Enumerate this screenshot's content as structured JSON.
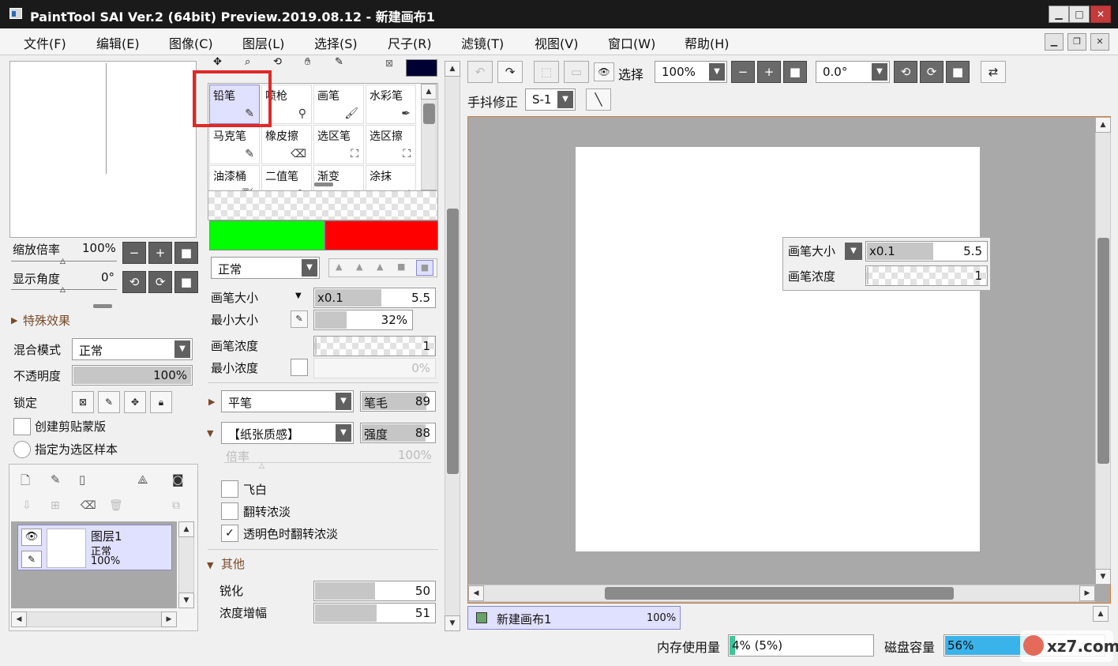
{
  "window": {
    "title": "PaintTool SAI Ver.2 (64bit) Preview.2019.08.12 - 新建画布1",
    "icon": "app-icon",
    "min": "▁",
    "max": "□",
    "close": "✕"
  },
  "menu": [
    "文件(F)",
    "编辑(E)",
    "图像(C)",
    "图层(L)",
    "选择(S)",
    "尺子(R)",
    "滤镜(T)",
    "视图(V)",
    "窗口(W)",
    "帮助(H)"
  ],
  "navigator": {
    "zoom_label": "缩放倍率",
    "zoom_value": "100%",
    "angle_label": "显示角度",
    "angle_value": "0°"
  },
  "effects": {
    "section": "特殊效果",
    "blend_label": "混合模式",
    "blend_value": "正常",
    "opacity_label": "不透明度",
    "opacity_value": "100%",
    "opacity_fraction": 1.0,
    "lock_label": "锁定",
    "clip_label": "创建剪贴蒙版",
    "sample_label": "指定为选区样本"
  },
  "layers": [
    {
      "name": "图层1",
      "mode": "正常",
      "opacity": "100%"
    }
  ],
  "tools": [
    {
      "name": "铅笔",
      "icon": "pencil-icon",
      "selected": true
    },
    {
      "name": "喷枪",
      "icon": "airbrush-icon"
    },
    {
      "name": "画笔",
      "icon": "brush-icon"
    },
    {
      "name": "水彩笔",
      "icon": "watercolor-icon"
    },
    {
      "name": "马克笔",
      "icon": "marker-icon"
    },
    {
      "name": "橡皮擦",
      "icon": "eraser-icon"
    },
    {
      "name": "选区笔",
      "icon": "selpen-icon"
    },
    {
      "name": "选区擦",
      "icon": "selerase-icon"
    },
    {
      "name": "油漆桶",
      "icon": "bucket-icon"
    },
    {
      "name": "二值笔",
      "icon": "binary-icon"
    },
    {
      "name": "渐变",
      "icon": "gradient-icon"
    },
    {
      "name": "涂抹",
      "icon": "smudge-icon"
    }
  ],
  "colors": {
    "primary": "#00ff00",
    "secondary": "#ff0000",
    "swatch": "#000033"
  },
  "brush": {
    "mode": "正常",
    "size_label": "画笔大小",
    "size_mult": "x0.1",
    "size_value": "5.5",
    "size_fraction": 0.6,
    "min_size_label": "最小大小",
    "min_size_value": "32%",
    "min_size_fraction": 0.32,
    "density_label": "画笔浓度",
    "density_value": "1",
    "density_fraction": 0.01,
    "min_density_label": "最小浓度",
    "min_density_value": "0%",
    "shape": "平笔",
    "bristle_label": "笔毛",
    "bristle_value": "89",
    "bristle_fraction": 0.89,
    "texture": "【纸张质感】",
    "strength_label": "强度",
    "strength_value": "88",
    "strength_fraction": 0.88,
    "scale_label": "倍率",
    "scale_value": "100%",
    "fly_white": "飞白",
    "invert_density": "翻转浓淡",
    "invert_transparent": "透明色时翻转浓淡",
    "other_section": "其他",
    "sharpen_label": "锐化",
    "sharpen_value": "50",
    "sharpen_fraction": 0.5,
    "density_boost_label": "浓度增幅",
    "density_boost_value": "51",
    "density_boost_fraction": 0.51
  },
  "toolbar": {
    "select_label": "选择",
    "zoom": "100%",
    "rotation": "0.0°",
    "stabilizer_label": "手抖修正",
    "stabilizer_value": "S-1"
  },
  "hud": {
    "size_label": "画笔大小",
    "size_mult": "x0.1",
    "size_value": "5.5",
    "density_label": "画笔浓度",
    "density_value": "1"
  },
  "canvas_tab": {
    "name": "新建画布1",
    "zoom": "100%"
  },
  "status": {
    "memory_label": "内存使用量",
    "memory_value": "4% (5%)",
    "memory_fraction": 0.04,
    "disk_label": "磁盘容量",
    "disk_value": "56%",
    "disk_fraction": 0.56
  },
  "watermark": {
    "text": "xz7.com"
  }
}
